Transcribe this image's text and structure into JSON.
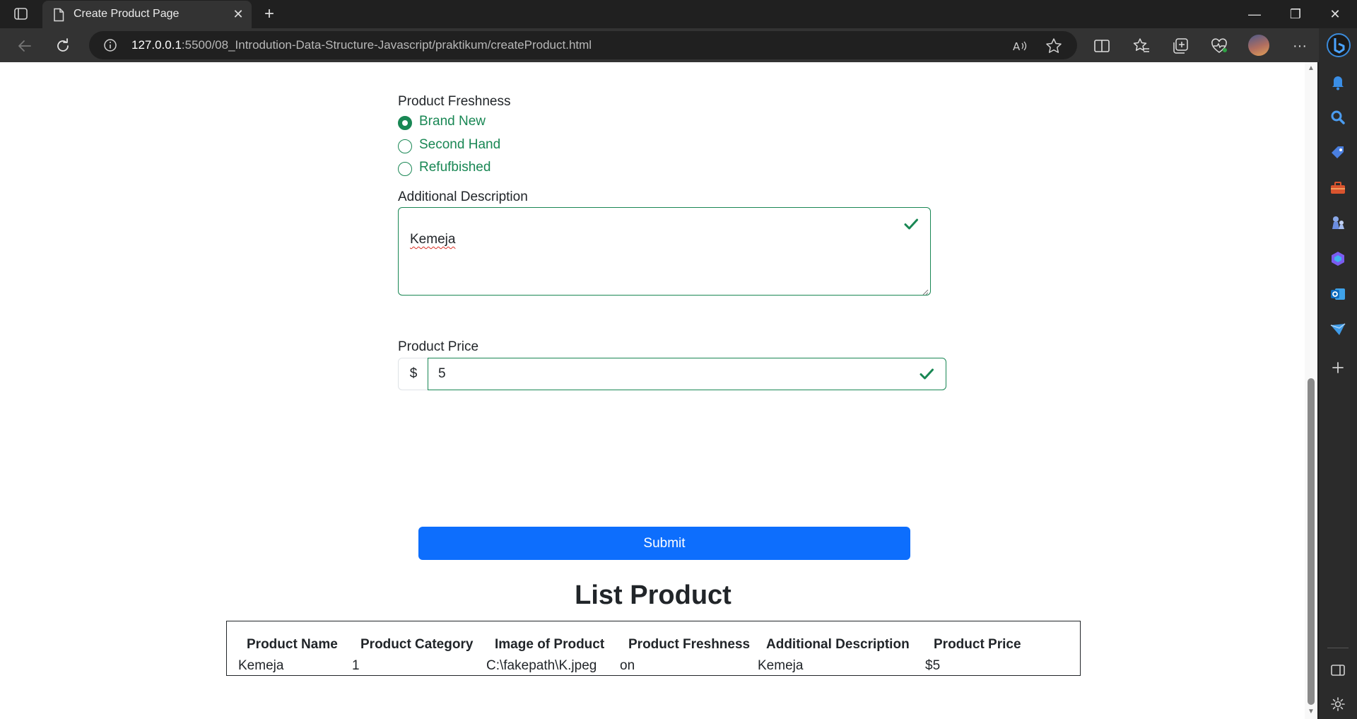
{
  "browser": {
    "tab_title": "Create Product Page",
    "tab_close": "✕",
    "new_tab": "+",
    "url_host": "127.0.0.1",
    "url_rest": ":5500/08_Introdution-Data-Structure-Javascript/praktikum/createProduct.html",
    "window_controls": {
      "minimize": "—",
      "restore": "❐",
      "close": "✕"
    },
    "more": "···"
  },
  "form": {
    "freshness_label": "Product Freshness",
    "freshness_options": [
      "Brand New",
      "Second Hand",
      "Refufbished"
    ],
    "freshness_selected": "Brand New",
    "description_label": "Additional Description",
    "description_value": "Kemeja",
    "price_label": "Product Price",
    "price_prefix": "$",
    "price_value": "5",
    "submit_label": "Submit"
  },
  "list": {
    "title": "List Product",
    "headers": [
      "Product Name",
      "Product Category",
      "Image of Product",
      "Product Freshness",
      "Additional Description",
      "Product Price"
    ],
    "rows": [
      [
        "Kemeja",
        "1",
        "C:\\fakepath\\K.jpeg",
        "on",
        "Kemeja",
        "$5"
      ]
    ]
  },
  "colors": {
    "success": "#198754",
    "primary": "#0d6efd",
    "chrome_dark": "#202020",
    "chrome_toolbar": "#333333"
  },
  "icons": {
    "tab_actions": "tab-actions-icon",
    "favicon": "page-icon",
    "back": "back-arrow-icon",
    "refresh": "refresh-icon",
    "site_info": "info-icon",
    "read_aloud": "read-aloud-icon",
    "favorite": "star-icon",
    "split_screen": "split-screen-icon",
    "favorites": "favorites-icon",
    "collections": "collections-icon",
    "browser_essentials": "heart-pulse-icon",
    "copilot": "copilot-icon",
    "sidebar": [
      "bell-icon",
      "search-icon",
      "shopping-tag-icon",
      "toolbox-icon",
      "games-icon",
      "office-icon",
      "outlook-icon",
      "drop-icon",
      "add-icon",
      "sidebar-toggle-icon",
      "settings-icon"
    ]
  }
}
